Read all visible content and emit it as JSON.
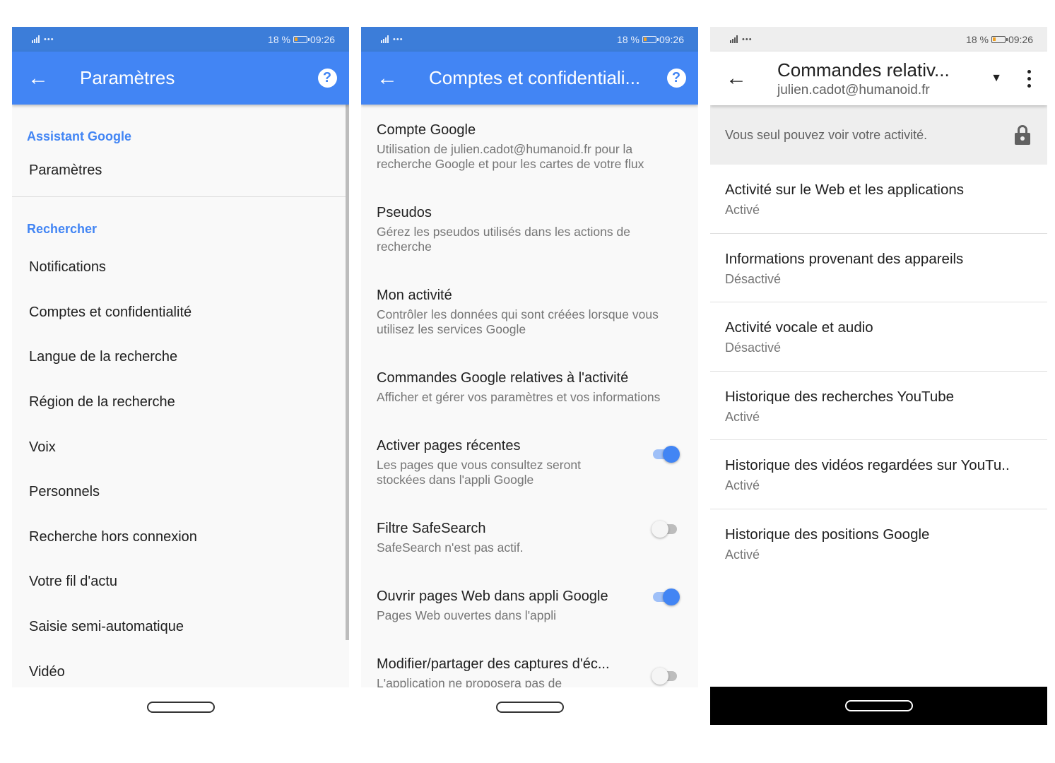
{
  "status_bar": {
    "left_icons": "•••",
    "battery": "18 %",
    "time": "09:26"
  },
  "panel1": {
    "title": "Paramètres",
    "section1_header": "Assistant Google",
    "section1_items": [
      "Paramètres"
    ],
    "section2_header": "Rechercher",
    "section2_items": [
      "Notifications",
      "Comptes et confidentialité",
      "Langue de la recherche",
      "Région de la recherche",
      "Voix",
      "Personnels",
      "Recherche hors connexion",
      "Votre fil d'actu",
      "Saisie semi-automatique",
      "Vidéo"
    ]
  },
  "panel2": {
    "title": "Comptes et confidentiali...",
    "items": [
      {
        "title": "Compte Google",
        "subtitle": "Utilisation de julien.cadot@humanoid.fr pour la recherche Google et pour les cartes de votre flux"
      },
      {
        "title": "Pseudos",
        "subtitle": "Gérez les pseudos utilisés dans les actions de recherche"
      },
      {
        "title": "Mon activité",
        "subtitle": "Contrôler les données qui sont créées lorsque vous utilisez les services Google"
      },
      {
        "title": "Commandes Google relatives à l'activité",
        "subtitle": "Afficher et gérer vos paramètres et vos informations"
      },
      {
        "title": "Activer pages récentes",
        "subtitle": "Les pages que vous consultez seront stockées dans l'appli Google",
        "toggle": true
      },
      {
        "title": "Filtre SafeSearch",
        "subtitle": "SafeSearch n'est pas actif.",
        "toggle": false
      },
      {
        "title": "Ouvrir pages Web dans appli Google",
        "subtitle": "Pages Web ouvertes dans l'appli",
        "toggle": true
      },
      {
        "title": "Modifier/partager des captures d'éc...",
        "subtitle": "L'application ne proposera pas de",
        "toggle": false
      }
    ]
  },
  "panel3": {
    "title": "Commandes relativ...",
    "account": "julien.cadot@humanoid.fr",
    "banner": "Vous seul pouvez voir votre activité.",
    "items": [
      {
        "title": "Activité sur le Web et les applications",
        "status": "Activé"
      },
      {
        "title": "Informations provenant des appareils",
        "status": "Désactivé"
      },
      {
        "title": "Activité vocale et audio",
        "status": "Désactivé"
      },
      {
        "title": "Historique des recherches YouTube",
        "status": "Activé"
      },
      {
        "title": "Historique des vidéos regardées sur YouTu..",
        "status": "Activé"
      },
      {
        "title": "Historique des positions Google",
        "status": "Activé"
      }
    ]
  },
  "colors": {
    "accent": "#4285f4",
    "status_blue": "#3c7dd9",
    "text_primary": "#212121",
    "text_secondary": "#757575"
  },
  "icons": {
    "back": "arrow-back-icon",
    "help": "help-icon",
    "dropdown": "dropdown-arrow-icon",
    "more": "more-vert-icon",
    "lock": "lock-icon"
  }
}
